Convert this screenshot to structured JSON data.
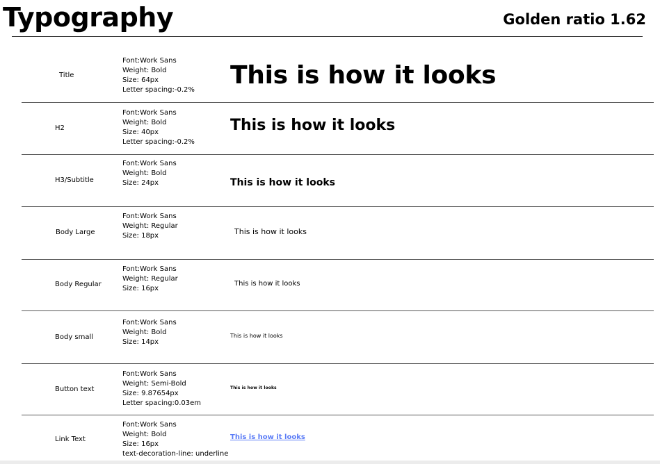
{
  "header": {
    "title": "Typography",
    "ratio": "Golden ratio 1.62"
  },
  "colors": {
    "text": "#000000",
    "link": "#5b7cf6",
    "rule": "#555555"
  },
  "rows": [
    {
      "label": "Title",
      "specs": [
        "Font:Work Sans",
        "Weight: Bold",
        "Size: 64px",
        "Letter spacing:-0.2%"
      ],
      "sample": "This is how it looks"
    },
    {
      "label": "H2",
      "specs": [
        "Font:Work Sans",
        "Weight: Bold",
        "Size: 40px",
        "Letter spacing:-0.2%"
      ],
      "sample": "This is how it looks"
    },
    {
      "label": "H3/Subtitle",
      "specs": [
        "Font:Work Sans",
        "Weight: Bold",
        "Size: 24px"
      ],
      "sample": "This is how it looks"
    },
    {
      "label": "Body Large",
      "specs": [
        "Font:Work Sans",
        "Weight: Regular",
        "Size: 18px"
      ],
      "sample": "This is how it looks"
    },
    {
      "label": "Body Regular",
      "specs": [
        "Font:Work Sans",
        "Weight: Regular",
        "Size: 16px"
      ],
      "sample": "This is how it looks"
    },
    {
      "label": "Body small",
      "specs": [
        "Font:Work Sans",
        "Weight: Bold",
        "Size: 14px"
      ],
      "sample": "This is how it looks"
    },
    {
      "label": "Button text",
      "specs": [
        "Font:Work Sans",
        "Weight: Semi-Bold",
        "Size: 9.87654px",
        "Letter spacing:0.03em"
      ],
      "sample": "This is how it looks"
    },
    {
      "label": "Link Text",
      "specs": [
        "Font:Work Sans",
        "Weight: Bold",
        "Size: 16px",
        "text-decoration-line: underline"
      ],
      "sample": "This is how it looks"
    }
  ]
}
